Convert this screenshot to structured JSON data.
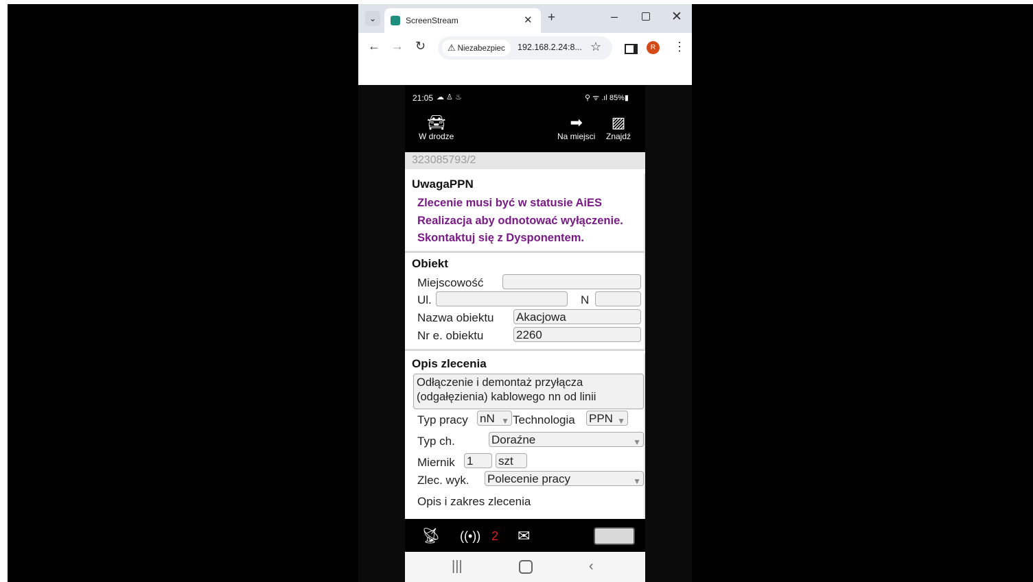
{
  "browser": {
    "tab_title": "ScreenStream",
    "tab_close": "✕",
    "new_tab": "+",
    "dropdown": "⌄",
    "security_label": "Niezabezpiec",
    "url": "192.168.2.24:8...",
    "profile_initial": "R",
    "back": "←",
    "forward": "→",
    "reload": "↻",
    "star": "☆",
    "menu": "⋮",
    "minimize": "–",
    "close": "✕"
  },
  "phone": {
    "status": {
      "time": "21:05",
      "left_icons": "☁ ♙ ♨",
      "right_text": "⚲ ᯤ .ıl 85%▮"
    },
    "appbar": {
      "on_the_way": "W drodze",
      "on_site": "Na miejsci",
      "find": "Znajdź"
    },
    "order_id": "323085793/2",
    "notice": {
      "title": "UwagaPPN",
      "lines": [
        "Zlecenie musi być w statusie AiES",
        "Realizacja aby odnotować wyłączenie.",
        "Skontaktuj się z Dysponentem."
      ]
    },
    "object": {
      "title": "Obiekt",
      "city_label": "Miejscowość",
      "city_value": "",
      "street_label": "Ul.",
      "street_value": "",
      "nr_label": "N",
      "nr_value": "",
      "name_label": "Nazwa obiektu",
      "name_value": "Akacjowa",
      "nr_obj_label": "Nr e. obiektu",
      "nr_obj_value": "2260"
    },
    "description": {
      "title": "Opis zlecenia",
      "text": "Odłączenie i demontaż przyłącza (odgałęzienia) kablowego nn od linii",
      "work_type_label": "Typ pracy",
      "work_type_value": "nN",
      "technology_label": "Technologia",
      "technology_value": "PPN",
      "type_ch_label": "Typ ch.",
      "type_ch_value": "Doraźne",
      "meter_label": "Miernik",
      "meter_value": "1",
      "meter_unit": "szt",
      "order_exec_label": "Zlec. wyk.",
      "order_exec_value": "Polecenie pracy",
      "scope_label": "Opis i zakres zlecenia"
    },
    "bottom": {
      "badge_count": "2"
    },
    "icons": {
      "car": "car-icon",
      "arrow": "arrow-right-icon",
      "map": "map-search-icon",
      "satellite": "satellite-icon",
      "signal": "signal-icon",
      "mail": "mail-icon",
      "keyboard": "keyboard-icon"
    }
  }
}
